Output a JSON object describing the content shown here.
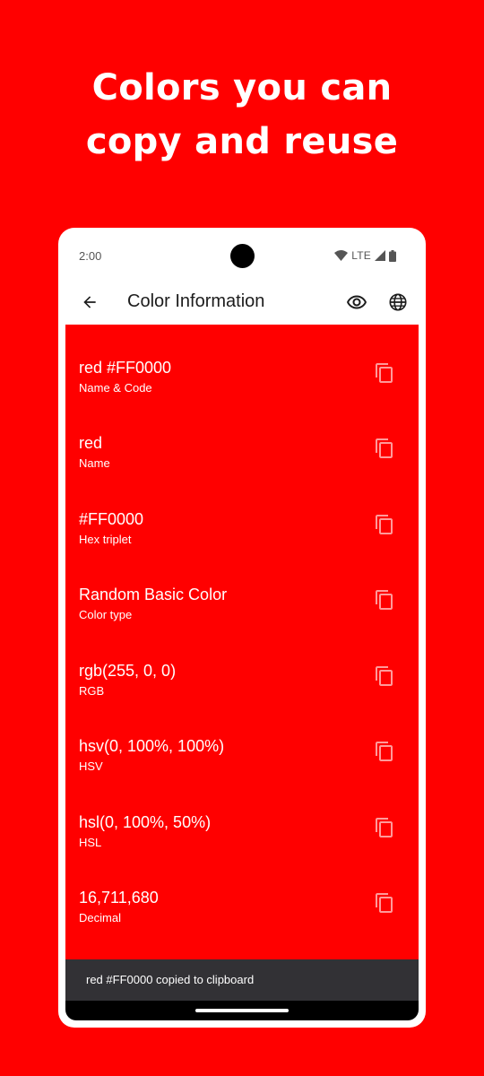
{
  "headline": {
    "line1": "Colors you can",
    "line2": "copy and reuse"
  },
  "status_bar": {
    "time": "2:00",
    "network": "LTE"
  },
  "app_bar": {
    "title": "Color Information"
  },
  "rows": [
    {
      "title": "red #FF0000",
      "subtitle": "Name & Code"
    },
    {
      "title": "red",
      "subtitle": "Name"
    },
    {
      "title": "#FF0000",
      "subtitle": "Hex triplet"
    },
    {
      "title": "Random Basic Color",
      "subtitle": "Color type"
    },
    {
      "title": "rgb(255, 0, 0)",
      "subtitle": "RGB"
    },
    {
      "title": "hsv(0, 100%, 100%)",
      "subtitle": "HSV"
    },
    {
      "title": "hsl(0, 100%, 50%)",
      "subtitle": "HSL"
    },
    {
      "title": "16,711,680",
      "subtitle": "Decimal"
    }
  ],
  "snackbar": {
    "message": "red #FF0000 copied to clipboard"
  },
  "colors": {
    "background": "#FF0000",
    "snackbar": "#323135",
    "text_on_red": "#FFFFFF"
  },
  "icons": [
    "back-arrow-icon",
    "eye-icon",
    "globe-icon",
    "copy-icon",
    "wifi-icon",
    "signal-icon",
    "battery-icon"
  ]
}
